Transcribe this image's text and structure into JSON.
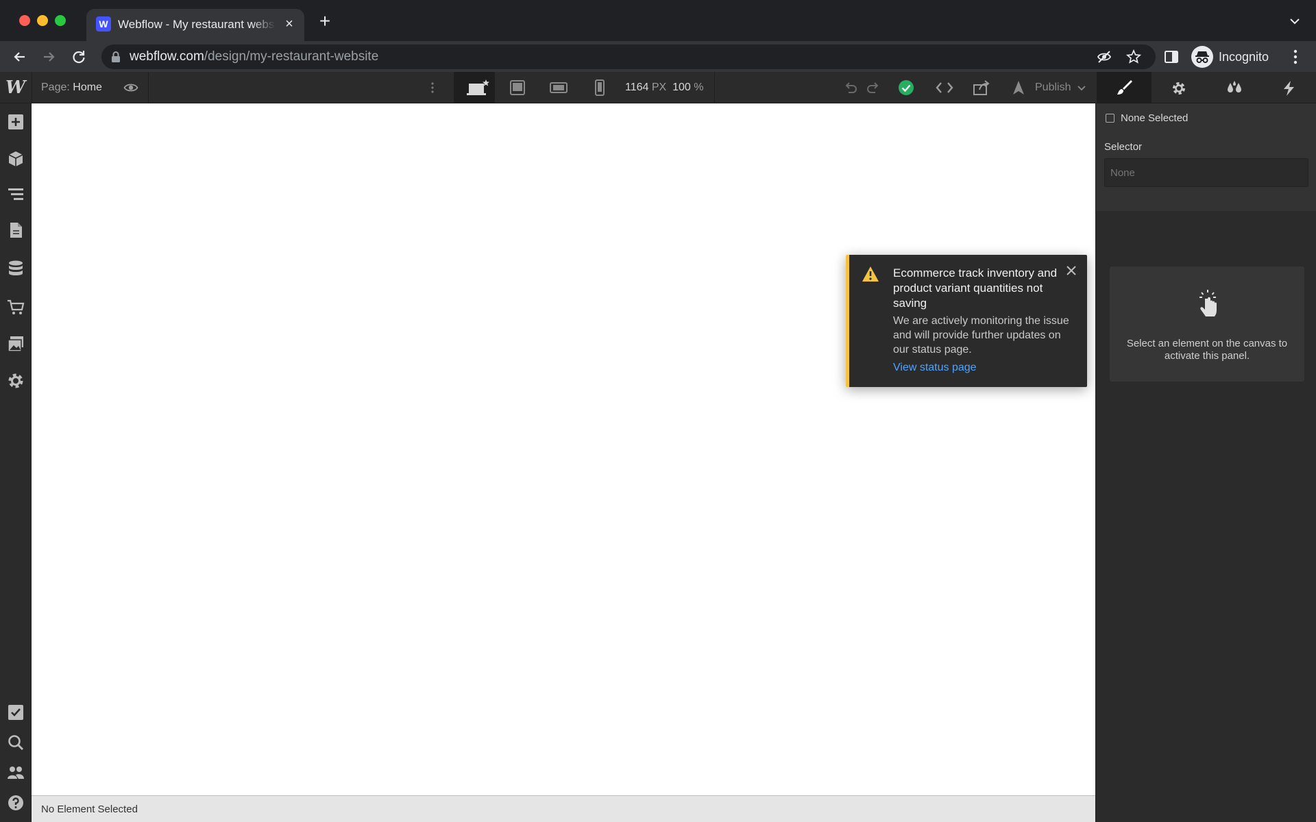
{
  "browser": {
    "tab_title": "Webflow - My restaurant website",
    "tab_favicon_letter": "W",
    "url_host": "webflow.com",
    "url_path": "/design/my-restaurant-website",
    "profile_label": "Incognito"
  },
  "designer": {
    "logo": "W",
    "page_prefix": "Page:",
    "page_name": "Home",
    "width_value": "1164",
    "width_unit": "PX",
    "zoom_value": "100",
    "zoom_unit": "%",
    "publish_label": "Publish",
    "status_bar": "No Element Selected"
  },
  "notification": {
    "title": "Ecommerce track inventory and product variant quantities not saving",
    "body": "We are actively monitoring the issue and will provide further updates on our status page.",
    "link_label": "View status page",
    "accent_color": "#f5c342"
  },
  "style_panel": {
    "none_selected_label": "None Selected",
    "selector_label": "Selector",
    "selector_placeholder": "None",
    "empty_message": "Select an element on the canvas to activate this panel."
  },
  "icons": {
    "left_sidebar": [
      "add-icon",
      "components-icon",
      "navigator-icon",
      "pages-icon",
      "cms-icon",
      "ecommerce-icon",
      "assets-icon",
      "settings-icon",
      "audit-icon",
      "search-icon",
      "users-icon",
      "help-icon"
    ],
    "right_tabs": [
      "style-brush-icon",
      "element-settings-icon",
      "style-manager-icon",
      "interactions-icon"
    ]
  },
  "colors": {
    "publish_check": "#27ae60",
    "link": "#4fa3ff"
  }
}
